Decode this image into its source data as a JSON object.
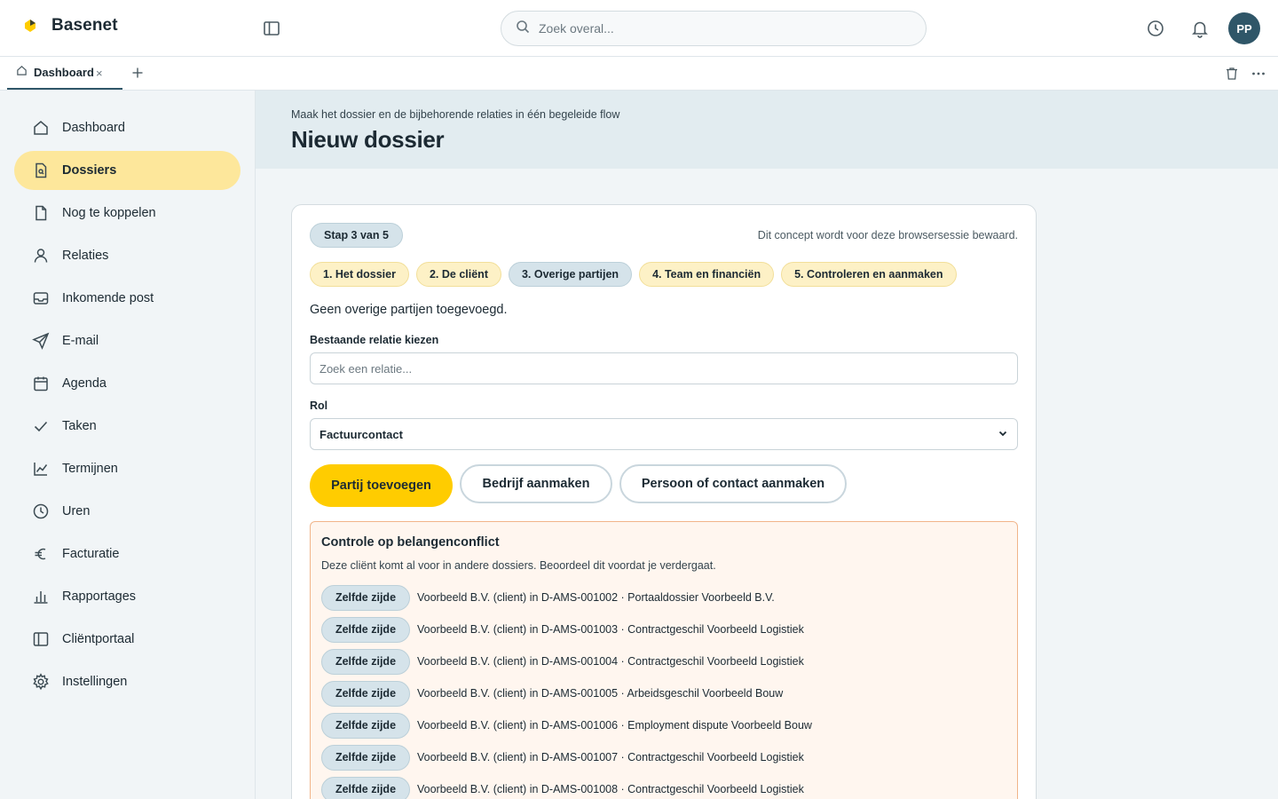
{
  "app": {
    "name": "Basenet"
  },
  "search": {
    "placeholder": "Zoek overal..."
  },
  "user": {
    "initials": "PP"
  },
  "tabs": [
    {
      "label": "Dashboard",
      "close": "×"
    }
  ],
  "sidebar": {
    "items": [
      {
        "label": "Dashboard",
        "icon": "home-icon"
      },
      {
        "label": "Dossiers",
        "icon": "file-icon",
        "active": true
      },
      {
        "label": "Nog te koppelen",
        "icon": "document-icon"
      },
      {
        "label": "Relaties",
        "icon": "user-icon"
      },
      {
        "label": "Inkomende post",
        "icon": "inbox-icon"
      },
      {
        "label": "E-mail",
        "icon": "send-icon"
      },
      {
        "label": "Agenda",
        "icon": "calendar-icon"
      },
      {
        "label": "Taken",
        "icon": "check-icon"
      },
      {
        "label": "Termijnen",
        "icon": "chart-line-icon"
      },
      {
        "label": "Uren",
        "icon": "clock-icon"
      },
      {
        "label": "Facturatie",
        "icon": "euro-icon"
      },
      {
        "label": "Rapportages",
        "icon": "bar-chart-icon"
      },
      {
        "label": "Cliëntportaal",
        "icon": "panel-icon"
      },
      {
        "label": "Instellingen",
        "icon": "gear-icon"
      }
    ]
  },
  "page": {
    "subtitle": "Maak het dossier en de bijbehorende relaties in één begeleide flow",
    "title": "Nieuw dossier"
  },
  "wizard": {
    "step_badge": "Stap 3 van 5",
    "concept_note": "Dit concept wordt voor deze browsersessie bewaard.",
    "steps": [
      {
        "label": "1. Het dossier"
      },
      {
        "label": "2. De cliënt"
      },
      {
        "label": "3. Overige partijen",
        "current": true
      },
      {
        "label": "4. Team en financiën"
      },
      {
        "label": "5. Controleren en aanmaken"
      }
    ],
    "empty_text": "Geen overige partijen toegevoegd.",
    "relation_label": "Bestaande relatie kiezen",
    "relation_placeholder": "Zoek een relatie...",
    "role_label": "Rol",
    "role_value": "Factuurcontact",
    "buttons": {
      "add_party": "Partij toevoegen",
      "create_company": "Bedrijf aanmaken",
      "create_person": "Persoon of contact aanmaken"
    }
  },
  "conflict": {
    "title": "Controle op belangenconflict",
    "description": "Deze cliënt komt al voor in andere dossiers. Beoordeel dit voordat je verdergaat.",
    "rows": [
      {
        "badge": "Zelfde zijde",
        "text": "Voorbeeld B.V. (client) in D-AMS-001002 · Portaaldossier Voorbeeld B.V."
      },
      {
        "badge": "Zelfde zijde",
        "text": "Voorbeeld B.V. (client) in D-AMS-001003 · Contractgeschil Voorbeeld Logistiek"
      },
      {
        "badge": "Zelfde zijde",
        "text": "Voorbeeld B.V. (client) in D-AMS-001004 · Contractgeschil Voorbeeld Logistiek"
      },
      {
        "badge": "Zelfde zijde",
        "text": "Voorbeeld B.V. (client) in D-AMS-001005 · Arbeidsgeschil Voorbeeld Bouw"
      },
      {
        "badge": "Zelfde zijde",
        "text": "Voorbeeld B.V. (client) in D-AMS-001006 · Employment dispute Voorbeeld Bouw"
      },
      {
        "badge": "Zelfde zijde",
        "text": "Voorbeeld B.V. (client) in D-AMS-001007 · Contractgeschil Voorbeeld Logistiek"
      },
      {
        "badge": "Zelfde zijde",
        "text": "Voorbeeld B.V. (client) in D-AMS-001008 · Contractgeschil Voorbeeld Logistiek"
      }
    ]
  },
  "colors": {
    "accent": "#ffcc00",
    "active_nav": "#fde79b",
    "avatar": "#2f5668",
    "conflict_border": "#f1b58a"
  }
}
